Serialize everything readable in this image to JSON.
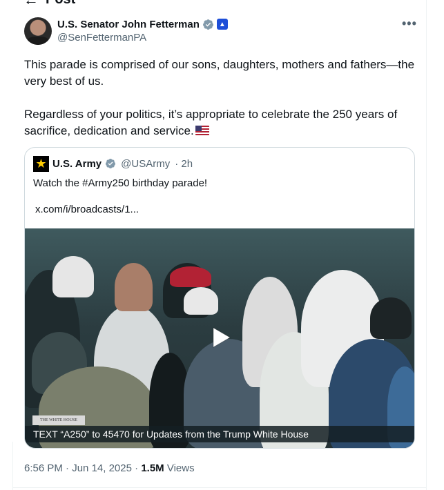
{
  "header": {
    "title": "Post",
    "back_icon": "back-arrow-icon"
  },
  "tweet": {
    "author_name": "U.S. Senator John Fetterman",
    "author_handle": "@SenFettermanPA",
    "more_label": "•••",
    "paragraphs": [
      "This parade is comprised of our sons, daughters, mothers and fathers—the very best of us.",
      "Regardless of your politics, it’s appropriate to celebrate the 250 years of sacrifice, dedication and service."
    ],
    "flag_icon": "us-flag-icon",
    "time": "6:56 PM",
    "date": "Jun 14, 2025",
    "views_count": "1.5M",
    "views_label": "Views",
    "separator": " · "
  },
  "quoted": {
    "author_name": "U.S. Army",
    "author_handle": "@USArmy",
    "age": "· 2h",
    "text": "Watch the #Army250 birthday parade!",
    "link": "x.com/i/broadcasts/1...",
    "video_logo": "THE WHITE HOUSE",
    "video_caption": "TEXT “A250” to 45470 for Updates from the Trump White House"
  },
  "colors": {
    "text": "#0f1419",
    "secondary": "#536471",
    "verified": "#829aab",
    "gov_badge": "#1d4ed8"
  }
}
